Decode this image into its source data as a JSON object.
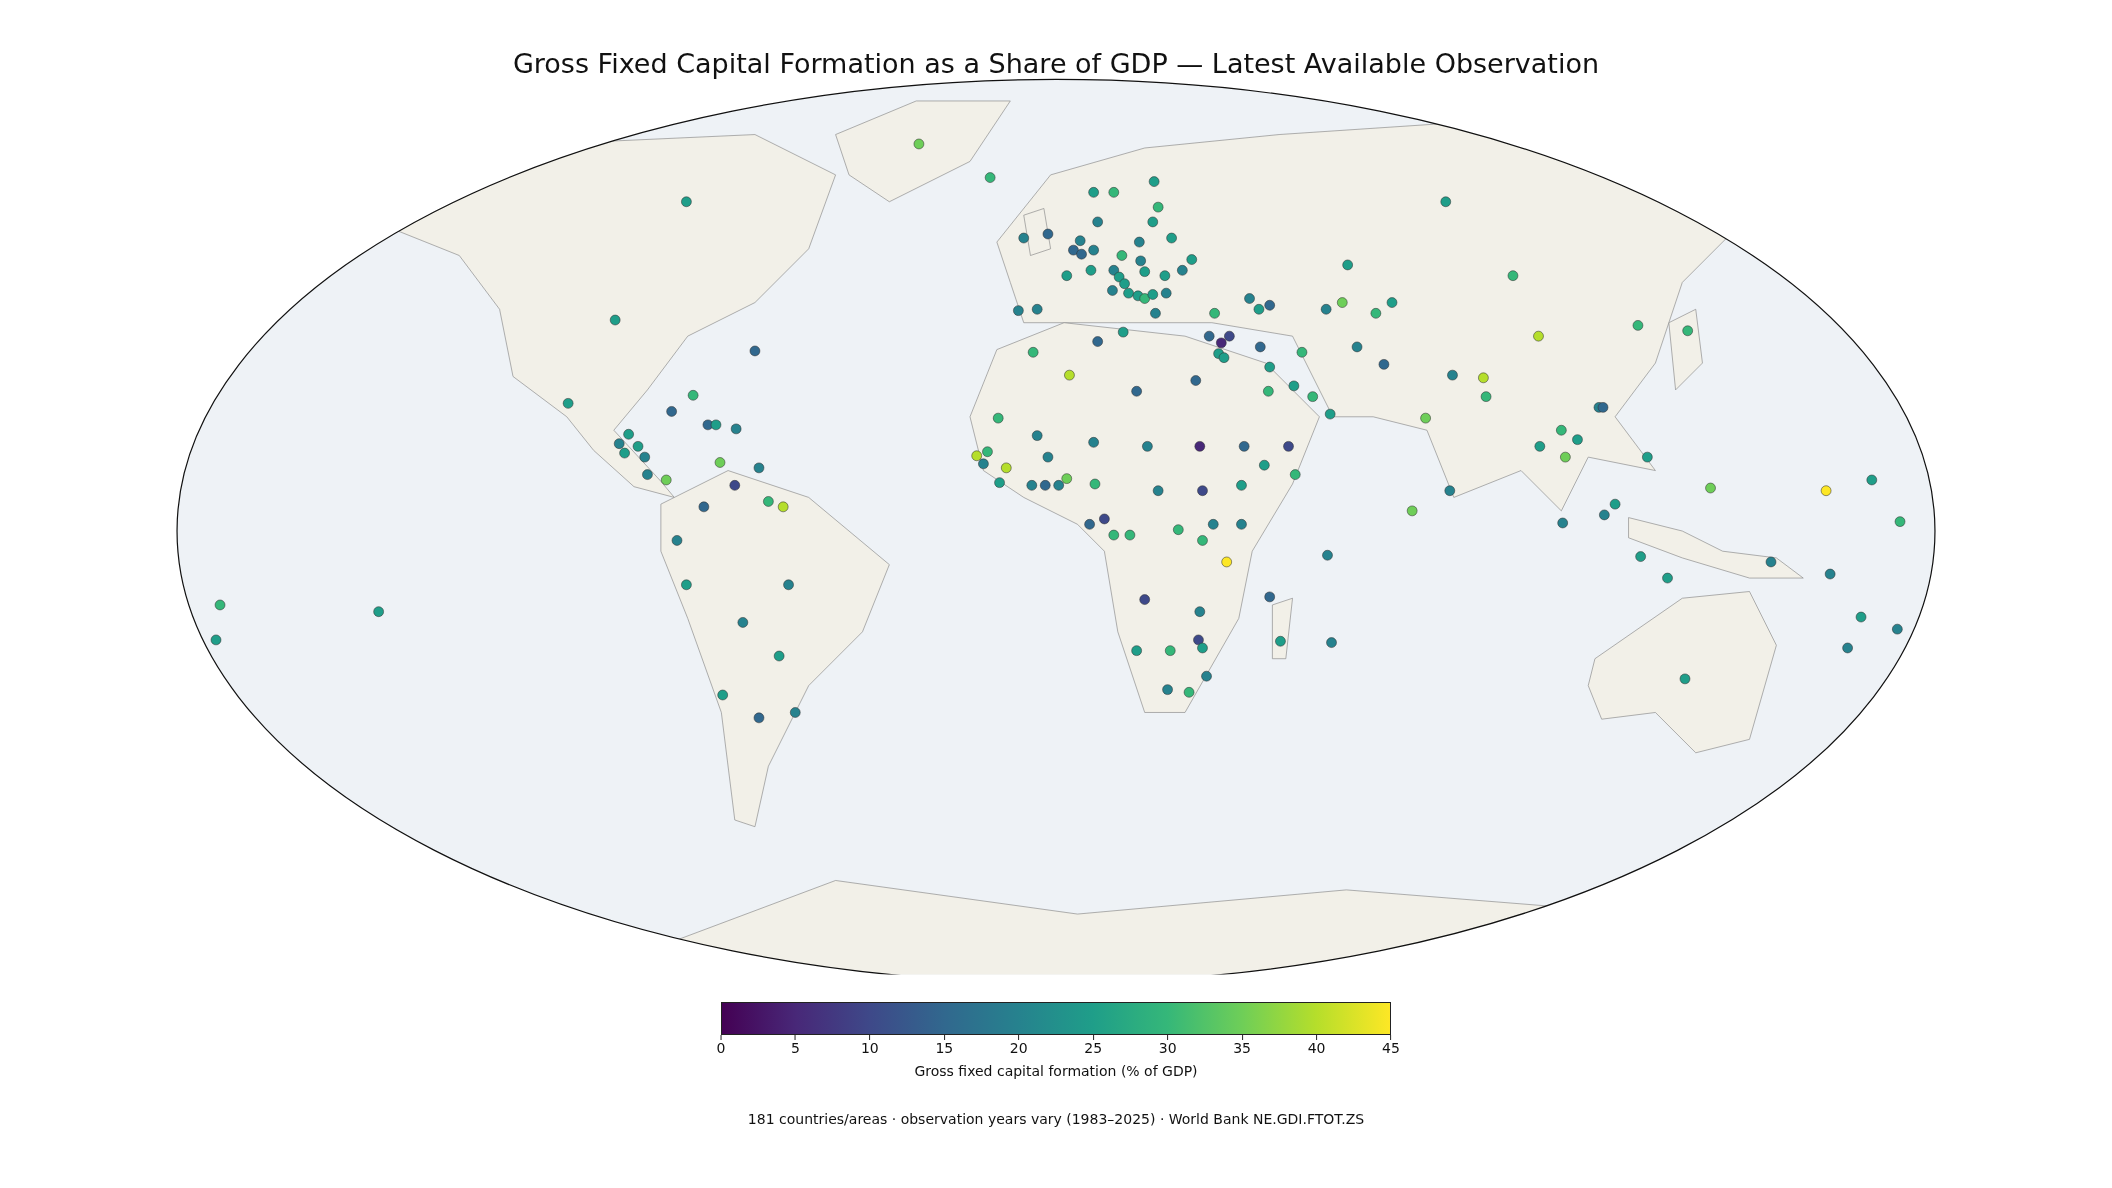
{
  "title": "Gross Fixed Capital Formation as a Share of GDP — Latest Available Observation",
  "colorbar": {
    "ticks": [
      "0",
      "5",
      "10",
      "15",
      "20",
      "25",
      "30",
      "35",
      "40",
      "45"
    ],
    "label": "Gross fixed capital formation (% of GDP)"
  },
  "footnote": "181 countries/areas · observation years vary (1983–2025) · World Bank NE.GDI.FTOT.ZS"
}
